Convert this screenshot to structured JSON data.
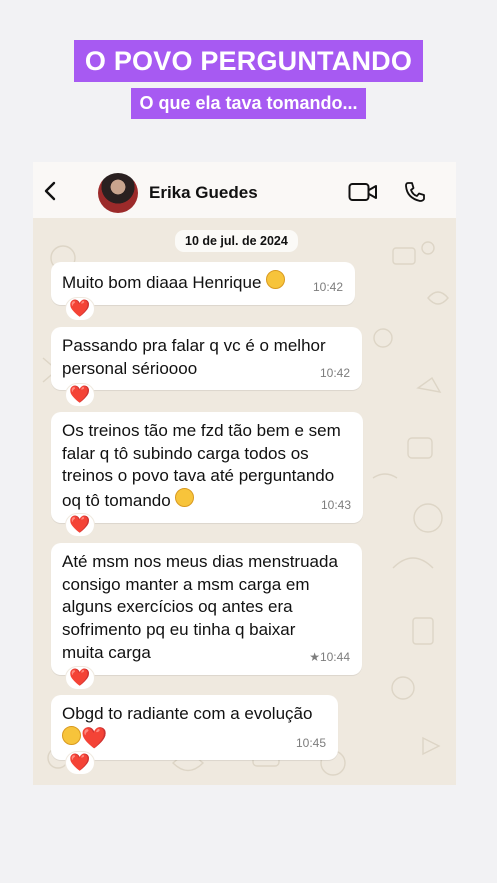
{
  "banner": {
    "title": "O POVO PERGUNTANDO",
    "subtitle": "O que ela tava tomando..."
  },
  "header": {
    "contact_name": "Erika Guedes",
    "icons": [
      "back-arrow-icon",
      "avatar",
      "video-call-icon",
      "phone-call-icon"
    ]
  },
  "chat": {
    "date": "10 de jul. de 2024",
    "messages": [
      {
        "text": "Muito bom diaaa Henrique",
        "emoji": "star-struck-emoji",
        "time": "10:42",
        "reaction": "❤️"
      },
      {
        "text": "Passando pra falar q vc é o melhor\npersonal sérioooo",
        "time": "10:42",
        "reaction": "❤️"
      },
      {
        "text": "Os treinos tão me fzd tão bem e sem\nfalar q tô subindo carga todos os\ntreinos o povo tava até perguntando\noq tô tomando",
        "emoji": "kissing-emoji",
        "time": "10:43",
        "reaction": "❤️"
      },
      {
        "text": "Até msm nos meus dias menstruada\nconsigo manter a msm carga em\nalguns exercícios oq antes era\nsofrimento pq eu tinha q baixar\nmuita carga",
        "time": "10:44",
        "starred": true,
        "time_label": "★10:44",
        "reaction": "❤️"
      },
      {
        "text": "Obgd to radiante com a evolução",
        "emoji": "star-struck-emoji",
        "heart": "❤️",
        "time": "10:45",
        "reaction": "❤️"
      }
    ]
  },
  "colors": {
    "banner_purple": "#a75af2",
    "chat_background": "#efe9df",
    "bubble": "#ffffff",
    "heart": "#e11b22"
  }
}
